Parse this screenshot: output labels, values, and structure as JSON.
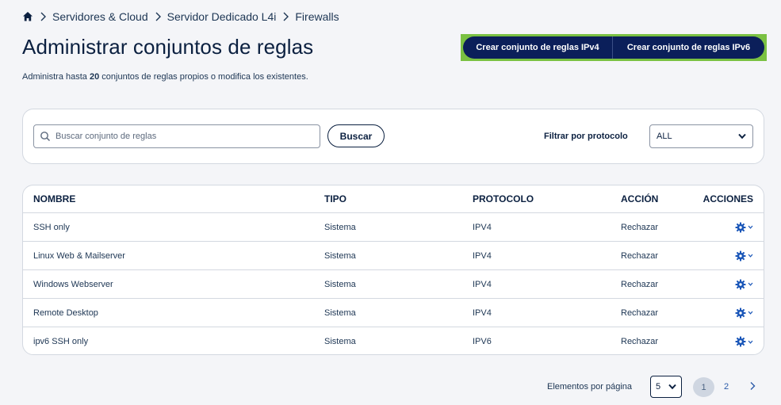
{
  "breadcrumb": {
    "items": [
      "Servidores & Cloud",
      "Servidor Dedicado L4i",
      "Firewalls"
    ]
  },
  "page": {
    "title": "Administrar conjuntos de reglas",
    "subtitle_before": "Administra hasta ",
    "subtitle_count": "20",
    "subtitle_after": " conjuntos de reglas propios o modifica los existentes."
  },
  "actions": {
    "create_ipv4": "Crear conjunto de reglas IPv4",
    "create_ipv6": "Crear conjunto de reglas IPv6"
  },
  "filters": {
    "search_placeholder": "Buscar conjunto de reglas",
    "search_value": "",
    "search_button": "Buscar",
    "protocol_label": "Filtrar por protocolo",
    "protocol_value": "ALL"
  },
  "table": {
    "headers": [
      "NOMBRE",
      "TIPO",
      "PROTOCOLO",
      "ACCIÓN",
      "ACCIONES"
    ],
    "rows": [
      {
        "name": "SSH only",
        "type": "Sistema",
        "protocol": "IPV4",
        "action": "Rechazar"
      },
      {
        "name": "Linux Web & Mailserver",
        "type": "Sistema",
        "protocol": "IPV4",
        "action": "Rechazar"
      },
      {
        "name": "Windows Webserver",
        "type": "Sistema",
        "protocol": "IPV4",
        "action": "Rechazar"
      },
      {
        "name": "Remote Desktop",
        "type": "Sistema",
        "protocol": "IPV4",
        "action": "Rechazar"
      },
      {
        "name": "ipv6 SSH only",
        "type": "Sistema",
        "protocol": "IPV6",
        "action": "Rechazar"
      }
    ]
  },
  "pagination": {
    "label": "Elementos por página",
    "page_size": "5",
    "pages": [
      "1",
      "2"
    ],
    "current": "1"
  },
  "colors": {
    "primary": "#0b1f5a",
    "highlight": "#7ac142",
    "gear": "#1a56b8"
  }
}
